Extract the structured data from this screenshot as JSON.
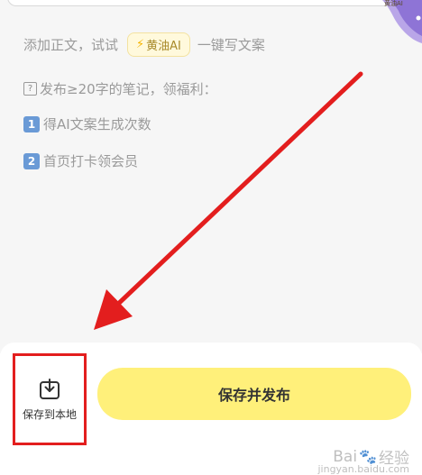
{
  "editor": {
    "hint_prefix": "添加正文，试试",
    "ai_chip_label": "黄油AI",
    "hint_suffix": "一键写文案",
    "reward_title": "发布≥20字的笔记，领福利：",
    "reward_items": [
      {
        "number": "1",
        "text": "得AI文案生成次数"
      },
      {
        "number": "2",
        "text": "首页打卡领会员"
      }
    ],
    "mascot_badge": "黄油AI"
  },
  "bottom_bar": {
    "save_local_label": "保存到本地",
    "publish_label": "保存并发布"
  },
  "watermark": {
    "brand_left": "Bai",
    "brand_right": "经验",
    "sub": "jingyan.baidu.com"
  },
  "colors": {
    "accent_yellow": "#fff07a",
    "annotation_red": "#e31e1e",
    "numkey_blue": "#6a9ad6"
  },
  "icons": {
    "save_local": "download-to-tray-icon",
    "ai_chip": "lightning-bolt-icon"
  }
}
